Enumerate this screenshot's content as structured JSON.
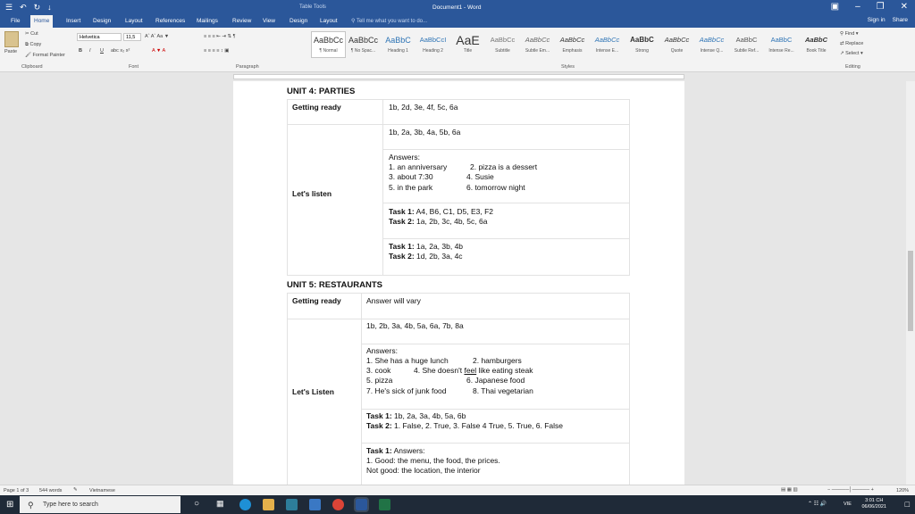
{
  "window": {
    "title": "Document1 - Word",
    "context_tab_group": "Table Tools",
    "quick_access": [
      "☰",
      "↶",
      "↻",
      "↓"
    ],
    "controls": [
      "▣",
      "–",
      "❐",
      "✕"
    ]
  },
  "ribbon_tabs": [
    "File",
    "Home",
    "Insert",
    "Design",
    "Layout",
    "References",
    "Mailings",
    "Review",
    "View",
    "Design",
    "Layout"
  ],
  "tell_me": "Tell me what you want to do...",
  "account": {
    "sign_in": "Sign in",
    "share": "Share"
  },
  "clipboard": {
    "paste": "Paste",
    "cut": "Cut",
    "copy": "Copy",
    "format_painter": "Format Painter",
    "label": "Clipboard"
  },
  "font": {
    "name": "Helvetica",
    "size": "11,5",
    "label": "Font",
    "bold": "B",
    "italic": "I",
    "underline": "U"
  },
  "paragraph_label": "Paragraph",
  "styles_label": "Styles",
  "styles": [
    {
      "preview": "AaBbCc",
      "name": "¶ Normal"
    },
    {
      "preview": "AaBbCc",
      "name": "¶ No Spac..."
    },
    {
      "preview": "AaBbC",
      "name": "Heading 1"
    },
    {
      "preview": "AaBbCcI",
      "name": "Heading 2"
    },
    {
      "preview": "AaE",
      "name": "Title"
    },
    {
      "preview": "AaBbCc",
      "name": "Subtitle"
    },
    {
      "preview": "AaBbCc",
      "name": "Subtle Em..."
    },
    {
      "preview": "AaBbCc",
      "name": "Emphasis"
    },
    {
      "preview": "AaBbCc",
      "name": "Intense E..."
    },
    {
      "preview": "AaBbC",
      "name": "Strong"
    },
    {
      "preview": "AaBbCc",
      "name": "Quote"
    },
    {
      "preview": "AaBbCc",
      "name": "Intense Q..."
    },
    {
      "preview": "AaBbC",
      "name": "Subtle Ref..."
    },
    {
      "preview": "AaBbC",
      "name": "Intense Re..."
    },
    {
      "preview": "AaBbC",
      "name": "Book Title"
    }
  ],
  "editing": {
    "find": "Find",
    "replace": "Replace",
    "select": "Select",
    "label": "Editing"
  },
  "document": {
    "unit4": {
      "title": "UNIT 4: PARTIES",
      "getting_ready_label": "Getting ready",
      "getting_ready_answer": "1b, 2d, 3e, 4f, 5c, 6a",
      "lets_listen_label": "Let's listen",
      "row1": "1b, 2a, 3b, 4a, 5b, 6a",
      "answers_label": "Answers:",
      "answers_line1a": "1. an anniversary",
      "answers_line1b": "2. pizza is a dessert",
      "answers_line2a": "3. about 7:30",
      "answers_line2b": "4. Susie",
      "answers_line3a": "5. in the park",
      "answers_line3b": "6. tomorrow night",
      "task_a1_label": "Task 1:",
      "task_a1": " A4, B6, C1, D5, E3, F2",
      "task_a2_label": "Task 2:",
      "task_a2": " 1a, 2b, 3c, 4b, 5c, 6a",
      "task_b1_label": "Task 1:",
      "task_b1": " 1a, 2a, 3b, 4b",
      "task_b2_label": "Task 2:",
      "task_b2": " 1d, 2b, 3a, 4c"
    },
    "unit5": {
      "title": "UNIT 5: RESTAURANTS",
      "getting_ready_label": "Getting ready",
      "getting_ready_answer": "Answer will vary",
      "lets_listen_label": "Let's Listen",
      "row1": "1b, 2b, 3a, 4b, 5a, 6a, 7b, 8a",
      "answers_label": "Answers:",
      "l1a": "1. She has a huge lunch",
      "l1b": "2. hamburgers",
      "l2a": "3. cook",
      "l2b_pre": "4. She doesn't ",
      "l2b_u": "feel",
      "l2b_post": " like eating steak",
      "l3a": "5. pizza",
      "l3b": "6. Japanese food",
      "l4a": "7. He's sick of junk food",
      "l4b": "8. Thai vegetarian",
      "task_a1_label": "Task 1:",
      "task_a1": " 1b, 2a, 3a, 4b, 5a, 6b",
      "task_a2_label": "Task 2:",
      "task_a2": " 1. False, 2. True, 3. False 4 True, 5. True, 6. False",
      "task_b1_label": "Task 1:",
      "task_b1": " Answers:",
      "task_b_l1": "1. Good: the menu, the food, the prices.",
      "task_b_l2": "Not good: the location, the interior"
    }
  },
  "status": {
    "page": "Page 1 of 3",
    "words": "544 words",
    "language": "Vietnamese",
    "zoom": "120%"
  },
  "taskbar": {
    "search_placeholder": "Type here to search",
    "time": "3:01 CH",
    "date": "06/06/2021",
    "lang": "VIE"
  }
}
